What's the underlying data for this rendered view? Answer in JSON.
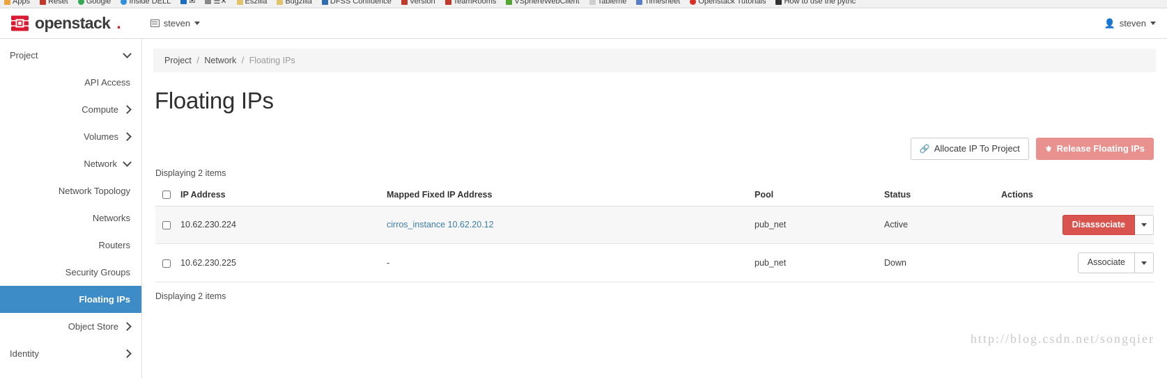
{
  "browser": {
    "bookmarks": [
      {
        "label": "Apps",
        "color": "#f0a33c"
      },
      {
        "label": "Reset",
        "color": "#c0392b"
      },
      {
        "label": "Google",
        "color": "#34a853"
      },
      {
        "label": "Inside DELL",
        "color": "#2f8fd8"
      },
      {
        "label": "✉",
        "color": "#1b6ec2"
      },
      {
        "label": "☰✕",
        "color": "#888888"
      },
      {
        "label": "Eszilla",
        "color": "#e3c36a"
      },
      {
        "label": "Bugzilla",
        "color": "#e3c36a"
      },
      {
        "label": "DFSS Confluence",
        "color": "#2f6fb0"
      },
      {
        "label": "Version",
        "color": "#c0392b"
      },
      {
        "label": "TeamRooms",
        "color": "#c0392b"
      },
      {
        "label": "VSphereWebClient",
        "color": "#55a630"
      },
      {
        "label": "Tableme",
        "color": "#cfcfcf"
      },
      {
        "label": "Timesheet",
        "color": "#5a7fc4"
      },
      {
        "label": "Openstack Tutorials",
        "color": "#d93025"
      },
      {
        "label": "How to use the pythc",
        "color": "#333333"
      }
    ]
  },
  "navbar": {
    "brand": "openstack",
    "brand_dot": ".",
    "project_name": "steven",
    "user_name": "steven",
    "user_icon": "user-icon",
    "project_icon": "project-selector-icon"
  },
  "sidebar": {
    "sections": [
      {
        "label": "Project",
        "type": "group",
        "icon": "chevron-down-icon",
        "expanded": true
      },
      {
        "label": "API Access",
        "type": "leaf",
        "active": false
      },
      {
        "label": "Compute",
        "type": "sub-group",
        "icon": "chevron-right-icon",
        "expanded": false
      },
      {
        "label": "Volumes",
        "type": "sub-group",
        "icon": "chevron-right-icon",
        "expanded": false
      },
      {
        "label": "Network",
        "type": "sub-group",
        "icon": "chevron-down-icon",
        "expanded": true
      },
      {
        "label": "Network Topology",
        "type": "leaf",
        "active": false
      },
      {
        "label": "Networks",
        "type": "leaf",
        "active": false
      },
      {
        "label": "Routers",
        "type": "leaf",
        "active": false
      },
      {
        "label": "Security Groups",
        "type": "leaf",
        "active": false
      },
      {
        "label": "Floating IPs",
        "type": "leaf",
        "active": true
      },
      {
        "label": "Object Store",
        "type": "sub-group",
        "icon": "chevron-right-icon",
        "expanded": false
      },
      {
        "label": "Identity",
        "type": "group",
        "icon": "chevron-right-icon",
        "expanded": false
      }
    ],
    "active_color": "#3e8cc7"
  },
  "breadcrumb": {
    "items": [
      "Project",
      "Network",
      "Floating IPs"
    ],
    "separator": "/"
  },
  "page": {
    "title": "Floating IPs",
    "items_count_top": "Displaying 2 items",
    "items_count_bottom": "Displaying 2 items"
  },
  "toolbar": {
    "allocate_label": "Allocate IP To Project",
    "allocate_icon": "link-chain-icon",
    "release_label": "Release Floating IPs",
    "release_icon": "unlink-chain-icon",
    "release_color": "#e8918e"
  },
  "table": {
    "columns": [
      "IP Address",
      "Mapped Fixed IP Address",
      "Pool",
      "Status",
      "Actions"
    ],
    "select_all_icon": "checkbox-icon",
    "rows": [
      {
        "selected": false,
        "ip_address": "10.62.230.224",
        "mapped_fixed_ip": "cirros_instance 10.62.20.12",
        "mapped_is_link": true,
        "pool": "pub_net",
        "status": "Active",
        "action_label": "Disassociate",
        "action_style": "danger",
        "action_color": "#d9534f"
      },
      {
        "selected": false,
        "ip_address": "10.62.230.225",
        "mapped_fixed_ip": "-",
        "mapped_is_link": false,
        "pool": "pub_net",
        "status": "Down",
        "action_label": "Associate",
        "action_style": "plain",
        "action_color": "#ffffff"
      }
    ]
  },
  "watermark": "http://blog.csdn.net/songqier"
}
